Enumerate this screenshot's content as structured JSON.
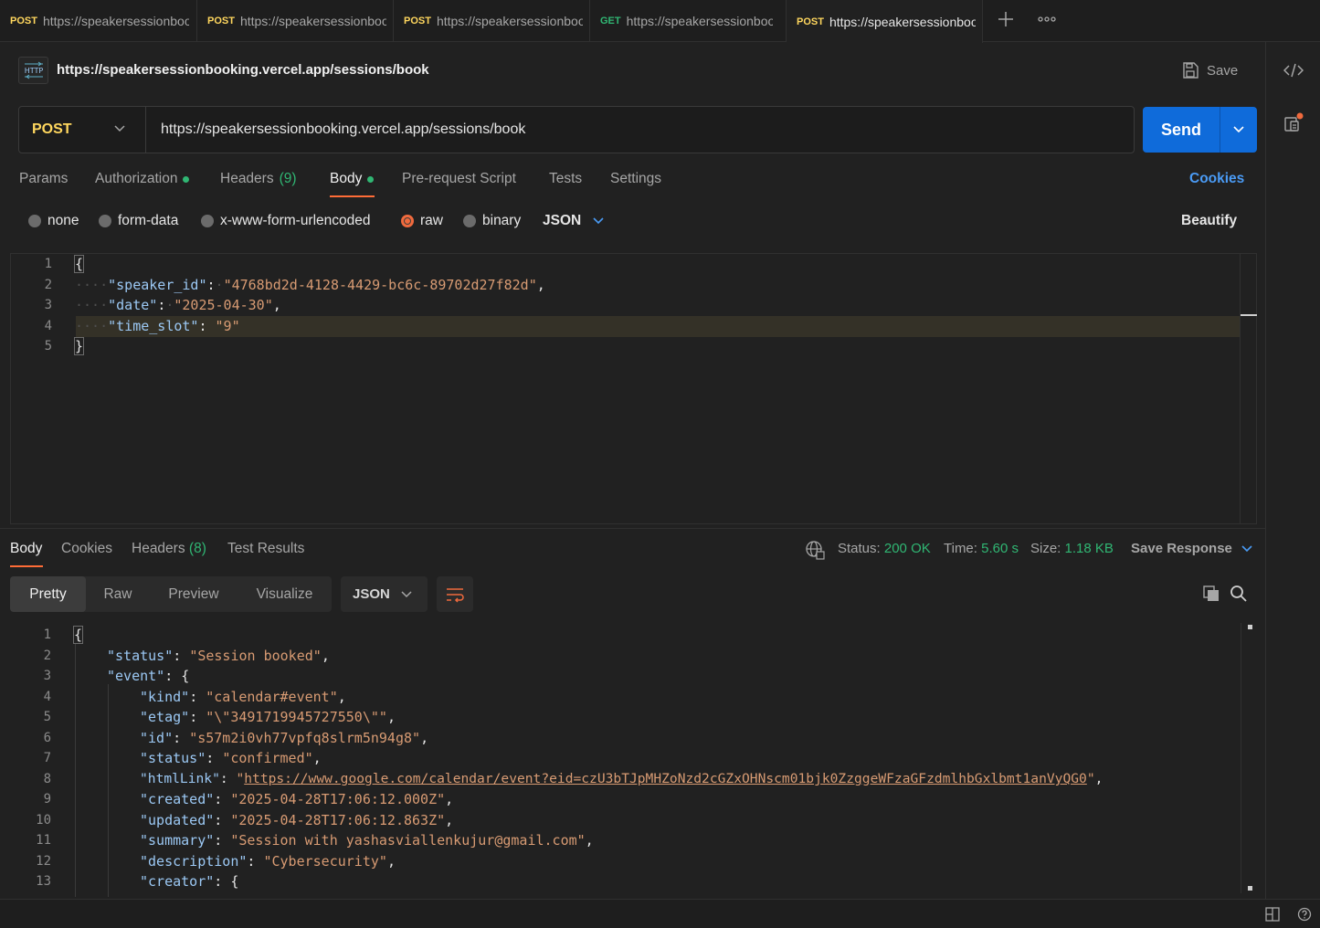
{
  "tabs": [
    {
      "method": "POST",
      "url": "https://speakersessionbooking.vercel.app/sessions/book"
    },
    {
      "method": "POST",
      "url": "https://speakersessionbooking.vercel.app/sessions/book"
    },
    {
      "method": "POST",
      "url": "https://speakersessionbooking.vercel.app/sessions/book"
    },
    {
      "method": "GET",
      "url": "https://speakersessionbooking.vercel.app/sessions/book"
    },
    {
      "method": "POST",
      "url": "https://speakersessionbooking.vercel.app/sessions/book"
    }
  ],
  "request": {
    "badge": "HTTP",
    "title": "https://speakersessionbooking.vercel.app/sessions/book",
    "save_label": "Save",
    "method": "POST",
    "url": "https://speakersessionbooking.vercel.app/sessions/book",
    "send_label": "Send"
  },
  "request_tabs": {
    "params": "Params",
    "authorization": "Authorization",
    "headers": "Headers",
    "headers_count": "(9)",
    "body": "Body",
    "pre_request": "Pre-request Script",
    "tests": "Tests",
    "settings": "Settings",
    "cookies": "Cookies"
  },
  "body_types": {
    "none": "none",
    "form_data": "form-data",
    "urlencoded": "x-www-form-urlencoded",
    "raw": "raw",
    "binary": "binary",
    "format": "JSON",
    "beautify": "Beautify"
  },
  "request_body": {
    "line_numbers": [
      "1",
      "2",
      "3",
      "4",
      "5"
    ],
    "open": "{",
    "close": "}",
    "k1": "\"speaker_id\"",
    "v1": "\"4768bd2d-4128-4429-bc6c-89702d27f82d\"",
    "k2": "\"date\"",
    "v2": "\"2025-04-30\"",
    "k3": "\"time_slot\"",
    "v3": "\"9\""
  },
  "response_tabs": {
    "body": "Body",
    "cookies": "Cookies",
    "headers": "Headers",
    "headers_count": "(8)",
    "test_results": "Test Results"
  },
  "response_meta": {
    "status_label": "Status:",
    "status_value": "200 OK",
    "time_label": "Time:",
    "time_value": "5.60 s",
    "size_label": "Size:",
    "size_value": "1.18 KB",
    "save_response": "Save Response"
  },
  "response_view": {
    "pretty": "Pretty",
    "raw": "Raw",
    "preview": "Preview",
    "visualize": "Visualize",
    "format": "JSON"
  },
  "response_body": {
    "line_numbers": [
      "1",
      "2",
      "3",
      "4",
      "5",
      "6",
      "7",
      "8",
      "9",
      "10",
      "11",
      "12",
      "13"
    ],
    "open": "{",
    "k_status": "\"status\"",
    "v_status": "\"Session booked\"",
    "k_event": "\"event\"",
    "k_kind": "\"kind\"",
    "v_kind": "\"calendar#event\"",
    "k_etag": "\"etag\"",
    "v_etag": "\"\\\"3491719945727550\\\"\"",
    "k_id": "\"id\"",
    "v_id": "\"s57m2i0vh77vpfq8slrm5n94g8\"",
    "k_estatus": "\"status\"",
    "v_estatus": "\"confirmed\"",
    "k_html": "\"htmlLink\"",
    "v_html": "https://www.google.com/calendar/event?eid=czU3bTJpMHZoNzd2cGZxOHNscm01bjk0ZzggeWFzaGFzdmlhbGxlbmt1anVyQG0",
    "k_created": "\"created\"",
    "v_created": "\"2025-04-28T17:06:12.000Z\"",
    "k_updated": "\"updated\"",
    "v_updated": "\"2025-04-28T17:06:12.863Z\"",
    "k_summary": "\"summary\"",
    "v_summary": "\"Session with yashasviallenkujur@gmail.com\"",
    "k_desc": "\"description\"",
    "v_desc": "\"Cybersecurity\"",
    "k_creator": "\"creator\""
  },
  "colors": {
    "accent": "#ff6c37",
    "send": "#0f6bda",
    "success": "#30b673",
    "post": "#ffd75e",
    "get": "#30b673"
  }
}
